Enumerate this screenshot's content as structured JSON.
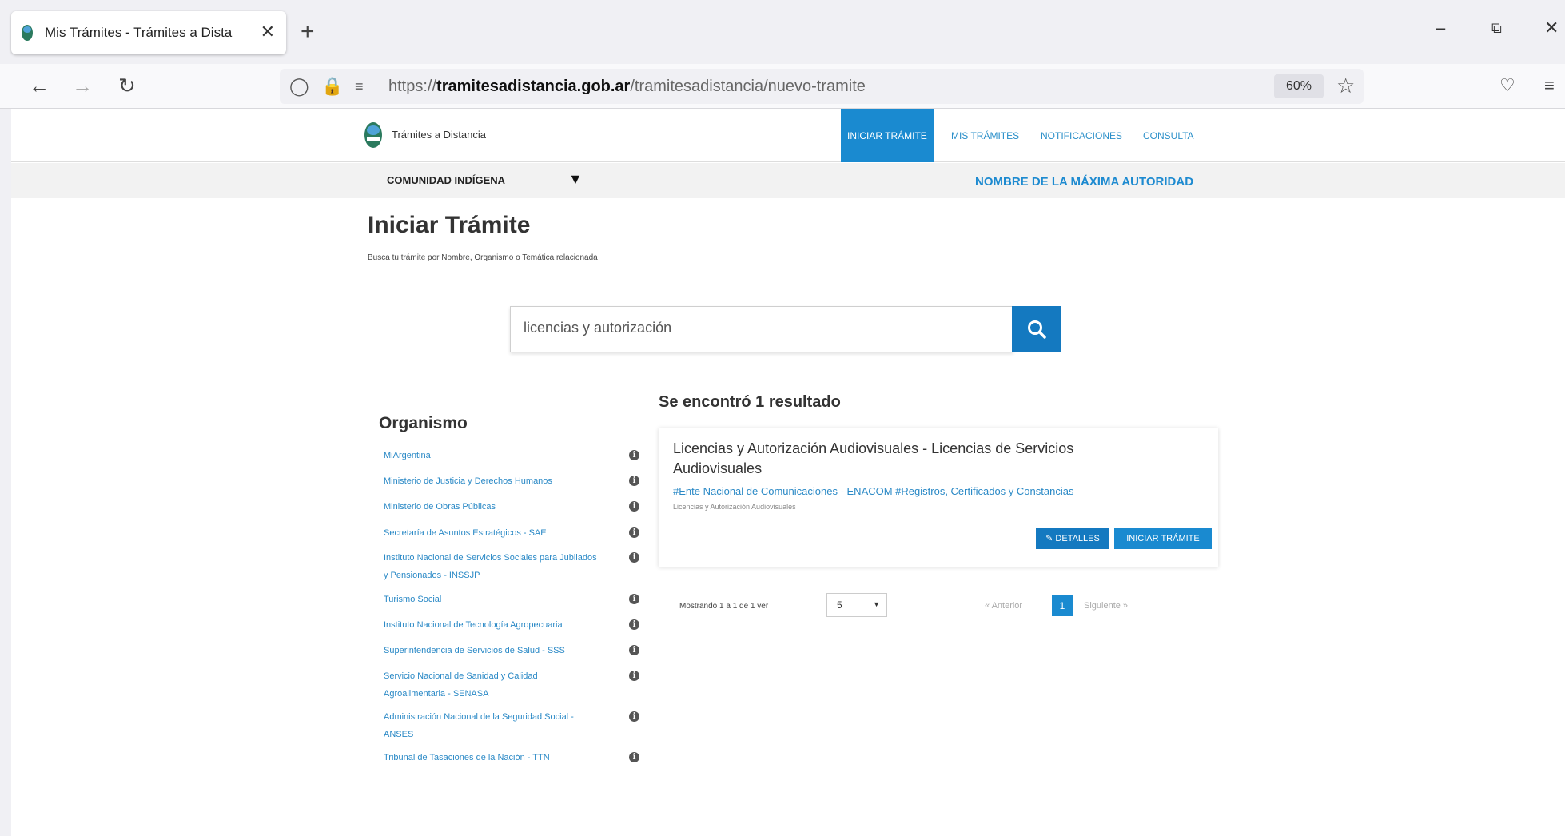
{
  "browser": {
    "tab_title": "Mis Trámites - Trámites a Dista",
    "tab_close": "✕",
    "new_tab": "+",
    "url_prefix": "https://",
    "url_domain": "tramitesadistancia.gob.ar",
    "url_path": "/tramitesadistancia/nuevo-tramite",
    "zoom": "60%"
  },
  "site": {
    "logo_text": "Trámites a Distancia",
    "nav": [
      "INICIAR TRÁMITE",
      "MIS TRÁMITES",
      "NOTIFICACIONES",
      "CONSULTA"
    ],
    "active_nav": "INICIAR TRÁMITE"
  },
  "subheader": {
    "selector": "COMUNIDAD INDÍGENA",
    "authority": "NOMBRE DE LA MÁXIMA AUTORIDAD"
  },
  "page": {
    "title": "Iniciar Trámite",
    "subtitle": "Busca tu trámite por Nombre, Organismo o Temática relacionada"
  },
  "search": {
    "value": "licencias y autorización"
  },
  "organismo": {
    "title": "Organismo",
    "items": [
      "MiArgentina",
      "Ministerio de Justicia y Derechos Humanos",
      "Ministerio de Obras Públicas",
      "Secretaría de Asuntos Estratégicos - SAE",
      "Instituto Nacional de Servicios Sociales para Jubilados y Pensionados - INSSJP",
      "Turismo Social",
      "Instituto Nacional de Tecnología Agropecuaria",
      "Superintendencia de Servicios de Salud - SSS",
      "Servicio Nacional de Sanidad y Calidad Agroalimentaria - SENASA",
      "Administración Nacional de la Seguridad Social - ANSES",
      "Tribunal de Tasaciones de la Nación - TTN"
    ]
  },
  "results": {
    "title": "Se encontró 1 resultado",
    "card": {
      "title": "Licencias y Autorización Audiovisuales - Licencias de Servicios Audiovisuales",
      "tags": "#Ente Nacional de Comunicaciones - ENACOM #Registros, Certificados y Constancias",
      "category": "Licencias y Autorización Audiovisuales",
      "btn_detalles": "✎ DETALLES",
      "btn_iniciar": "INICIAR TRÁMITE"
    },
    "pager": {
      "info": "Mostrando 1 a 1 de 1 ver",
      "page_size": "5",
      "prev": "« Anterior",
      "current": "1",
      "next": "Siguiente »"
    }
  },
  "colors": {
    "accent": "#1479c0",
    "link": "#2a89c6"
  }
}
